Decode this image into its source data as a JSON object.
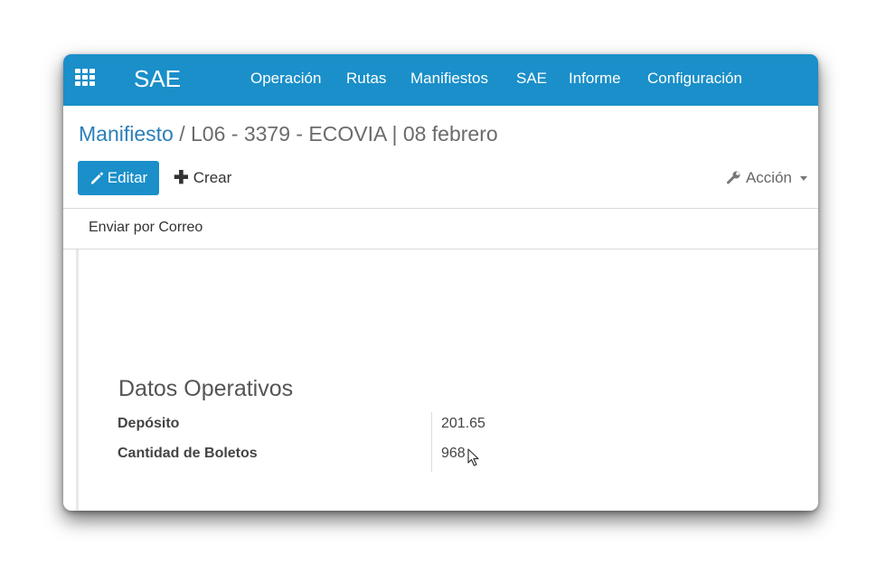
{
  "topbar": {
    "apps_icon": "apps-grid-icon",
    "brand": "SAE",
    "menu": [
      "Operación",
      "Rutas",
      "Manifiestos",
      "SAE",
      "Informe",
      "Configuración"
    ]
  },
  "breadcrumb": {
    "parent": "Manifiesto",
    "separator": "/",
    "current": "L06 - 3379 - ECOVIA | 08 febrero"
  },
  "buttons": {
    "edit_label": "Editar",
    "edit_icon": "pencil-icon",
    "create_label": "Crear",
    "create_icon": "plus-icon",
    "action_label": "Acción",
    "action_icon": "wrench-icon"
  },
  "toolbar2": {
    "send_mail_label": "Enviar por Correo"
  },
  "section": {
    "title": "Datos Operativos",
    "fields": [
      {
        "label": "Depósito",
        "value": "201.65"
      },
      {
        "label": "Cantidad de Boletos",
        "value": "968"
      }
    ]
  },
  "colors": {
    "primary": "#1a8fc9",
    "link": "#2c7fba"
  }
}
